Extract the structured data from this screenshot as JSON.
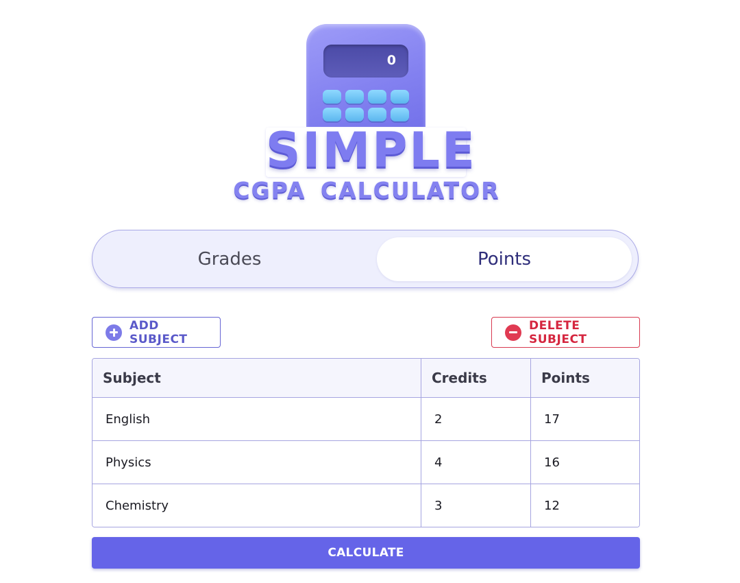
{
  "logo": {
    "display_value": "0",
    "title": "SIMPLE",
    "subtitle": "CGPA CALCULATOR",
    "icon": "calculator-icon"
  },
  "mode_toggle": {
    "options": [
      "Grades",
      "Points"
    ],
    "selected": "Points"
  },
  "actions": {
    "add_label": "ADD SUBJECT",
    "add_icon": "plus-circle-icon",
    "delete_label": "DELETE SUBJECT",
    "delete_icon": "minus-circle-icon"
  },
  "table": {
    "headers": [
      "Subject",
      "Credits",
      "Points"
    ],
    "rows": [
      [
        "English",
        "2",
        "17"
      ],
      [
        "Physics",
        "4",
        "16"
      ],
      [
        "Chemistry",
        "3",
        "12"
      ]
    ]
  },
  "calculate": {
    "label": "CALCULATE"
  },
  "colors": {
    "accent": "#6564e8",
    "danger": "#d5263f",
    "toggle_bg": "#eeeffd",
    "border": "#a5a4e0"
  }
}
